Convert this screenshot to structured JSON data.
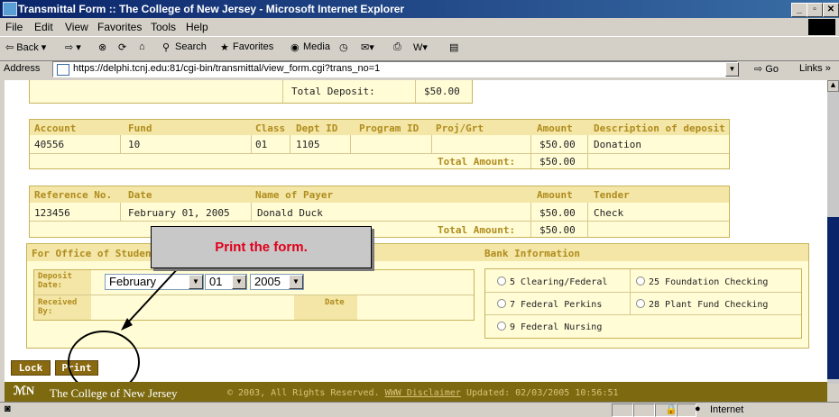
{
  "window": {
    "title": "Transmittal Form :: The College of New Jersey - Microsoft Internet Explorer"
  },
  "menu": [
    "File",
    "Edit",
    "View",
    "Favorites",
    "Tools",
    "Help"
  ],
  "toolbar": {
    "back": "⇦ Back ▾",
    "forward": "⇨ ▾",
    "search": "Search",
    "favorites": "Favorites",
    "media": "Media"
  },
  "address": {
    "label": "Address",
    "url": "https://delphi.tcnj.edu:81/cgi-bin/transmittal/view_form.cgi?trans_no=1",
    "go": "Go",
    "links": "Links »"
  },
  "deposit_summary": {
    "label": "Total Deposit:",
    "value": "$50.00"
  },
  "account_table": {
    "headers": [
      "Account",
      "Fund",
      "Class",
      "Dept ID",
      "Program ID",
      "Proj/Grt",
      "Amount",
      "Description of deposit"
    ],
    "row": [
      "40556",
      "10",
      "01",
      "1105",
      "",
      "",
      "$50.00",
      "Donation"
    ],
    "total_label": "Total Amount:",
    "total_value": "$50.00"
  },
  "payer_table": {
    "headers": [
      "Reference No.",
      "Date",
      "Name of Payer",
      "Amount",
      "Tender"
    ],
    "row": [
      "123456",
      "February 01, 2005",
      "Donald Duck",
      "$50.00",
      "Check"
    ],
    "total_label": "Total Amount:",
    "total_value": "$50.00"
  },
  "office": {
    "title": "For Office of Studen",
    "deposit_date_label": "Deposit Date:",
    "received_by_label": "Received By:",
    "date_label": "Date",
    "month": "February",
    "day": "01",
    "year": "2005"
  },
  "bank": {
    "title": "Bank Information",
    "options": [
      "5 Clearing/Federal",
      "25 Foundation Checking",
      "7 Federal Perkins",
      "28 Plant Fund Checking",
      "9 Federal Nursing"
    ]
  },
  "callout": {
    "text": "Print the form."
  },
  "buttons": {
    "lock": "Lock",
    "print": "Print"
  },
  "footer": {
    "logo": "ℳN",
    "name": "The College of New Jersey",
    "copyright": "© 2003, All Rights Reserved.",
    "disclaimer": "WWW Disclaimer",
    "updated": "Updated: 02/03/2005 10:56:51"
  },
  "status": {
    "zone": "Internet"
  }
}
